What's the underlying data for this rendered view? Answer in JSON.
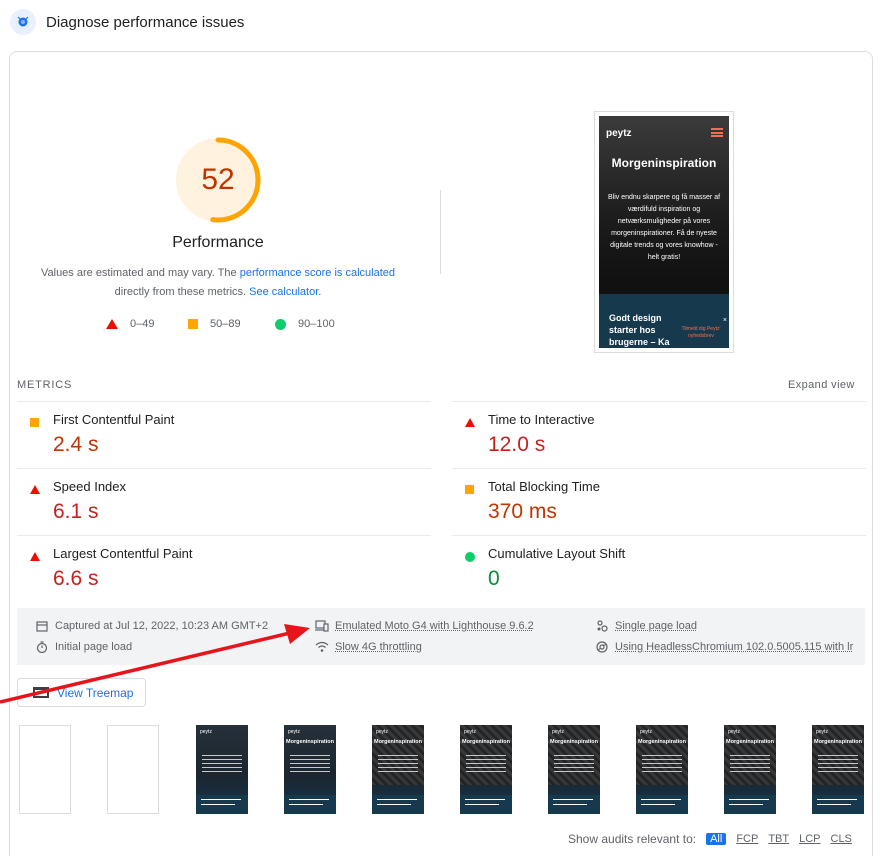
{
  "header": {
    "title": "Diagnose performance issues",
    "icon": "lighthouse-icon"
  },
  "gauge": {
    "score": "52",
    "title": "Performance",
    "fraction": 0.52,
    "color": "#ffa400",
    "text_color": "#c33300"
  },
  "description": {
    "part1": "Values are estimated and may vary. The ",
    "link1": "performance score is calculated",
    "part2": "directly from these metrics. ",
    "link2": "See calculator."
  },
  "legend": [
    {
      "shape": "triangle",
      "label": "0–49",
      "color": "#eb0f00"
    },
    {
      "shape": "square",
      "label": "50–89",
      "color": "#ffa400"
    },
    {
      "shape": "circle",
      "label": "90–100",
      "color": "#0cce6b"
    }
  ],
  "screenshot": {
    "brand": "peytz",
    "heading": "Morgeninspiration",
    "body": "Bliv endnu skarpere og få masser af værdifuld inspiration og netværksmuligheder på vores morgeninspirationer. Få de nyeste digitale trends og vores knowhow - helt gratis!",
    "footer_text": "Godt design starter hos brugerne – Ka",
    "footer_cta": "Tilmeld dig Peytz' nyhedsbrev",
    "close": "×"
  },
  "metrics_section": {
    "label": "METRICS",
    "expand": "Expand view"
  },
  "metrics": [
    {
      "name": "First Contentful Paint",
      "value": "2.4 s",
      "rating": "square",
      "color": "#c33300"
    },
    {
      "name": "Time to Interactive",
      "value": "12.0 s",
      "rating": "triangle",
      "color": "#c5221f"
    },
    {
      "name": "Speed Index",
      "value": "6.1 s",
      "rating": "triangle",
      "color": "#c5221f"
    },
    {
      "name": "Total Blocking Time",
      "value": "370 ms",
      "rating": "square",
      "color": "#c33300"
    },
    {
      "name": "Largest Contentful Paint",
      "value": "6.6 s",
      "rating": "triangle",
      "color": "#c5221f"
    },
    {
      "name": "Cumulative Layout Shift",
      "value": "0",
      "rating": "circle",
      "color": "#0d8a3e"
    }
  ],
  "info": {
    "captured": "Captured at Jul 12, 2022, 10:23 AM GMT+2",
    "initial": "Initial page load",
    "emulated": "Emulated Moto G4 with Lighthouse 9.6.2",
    "throttling": "Slow 4G throttling",
    "single": "Single page load",
    "browser": "Using HeadlessChromium 102.0.5005.115 with lr"
  },
  "treemap": {
    "label": "View Treemap"
  },
  "filmstrip": {
    "frames": [
      "blank",
      "blank",
      "text",
      "text",
      "photo",
      "photo",
      "photo",
      "photo",
      "photo",
      "photo"
    ],
    "brand": "peytz",
    "heading": "Morgeninspiration"
  },
  "audits": {
    "label": "Show audits relevant to:",
    "filters": [
      "All",
      "FCP",
      "TBT",
      "LCP",
      "CLS"
    ],
    "active": "All"
  },
  "accent_color": "#1a73e8",
  "annotation_arrow_color": "#e8141b"
}
